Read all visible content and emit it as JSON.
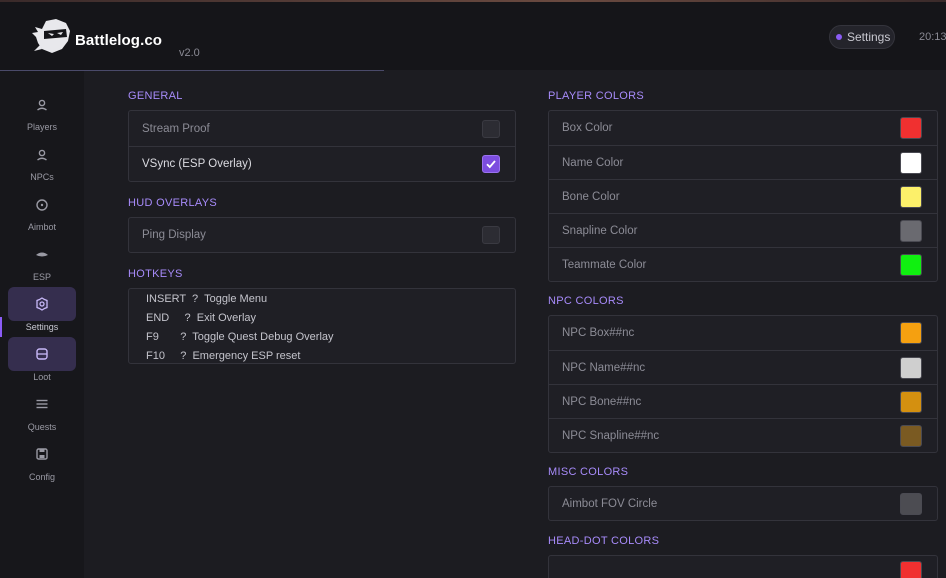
{
  "app": {
    "brand": "Battlelog.co",
    "version": "v2.0",
    "header_button": "Settings",
    "clock": "20:13"
  },
  "sidebar": {
    "items": [
      {
        "label": "Players",
        "icon": "user-icon"
      },
      {
        "label": "NPCs",
        "icon": "user-icon"
      },
      {
        "label": "Aimbot",
        "icon": "crosshair-icon"
      },
      {
        "label": "ESP",
        "icon": "eye-icon"
      },
      {
        "label": "Settings",
        "icon": "gear-icon",
        "active": true
      },
      {
        "label": "Loot",
        "icon": "box-icon"
      },
      {
        "label": "Quests",
        "icon": "list-icon"
      },
      {
        "label": "Config",
        "icon": "save-icon"
      }
    ]
  },
  "general": {
    "title": "GENERAL",
    "stream_proof": {
      "label": "Stream Proof",
      "checked": false
    },
    "vsync": {
      "label": "VSync (ESP Overlay)",
      "checked": true
    }
  },
  "hud": {
    "title": "HUD OVERLAYS",
    "ping": {
      "label": "Ping Display",
      "checked": false
    }
  },
  "hotkeys": {
    "title": "HOTKEYS",
    "lines": [
      "INSERT  ?  Toggle Menu",
      "END     ?  Exit Overlay",
      "F9       ?  Toggle Quest Debug Overlay",
      "F10     ?  Emergency ESP reset"
    ]
  },
  "player_colors": {
    "title": "PLAYER COLORS",
    "items": [
      {
        "label": "Box Color",
        "color": "#f03030"
      },
      {
        "label": "Name Color",
        "color": "#ffffff"
      },
      {
        "label": "Bone Color",
        "color": "#fcf06a"
      },
      {
        "label": "Snapline Color",
        "color": "#6a6a70"
      },
      {
        "label": "Teammate Color",
        "color": "#10f010"
      }
    ]
  },
  "npc_colors": {
    "title": "NPC COLORS",
    "items": [
      {
        "label": "NPC Box##nc",
        "color": "#f5a010"
      },
      {
        "label": "NPC Name##nc",
        "color": "#cfcfcf"
      },
      {
        "label": "NPC Bone##nc",
        "color": "#d49010"
      },
      {
        "label": "NPC Snapline##nc",
        "color": "#7a5a22"
      }
    ]
  },
  "misc_colors": {
    "title": "MISC COLORS",
    "items": [
      {
        "label": "Aimbot FOV Circle",
        "color": "#4c4c52"
      }
    ]
  },
  "headdot_colors": {
    "title": "HEAD-DOT COLORS"
  },
  "colors": {
    "accent": "#8b5cf6",
    "section_title": "#a78bfa",
    "background": "#1c1c21"
  }
}
